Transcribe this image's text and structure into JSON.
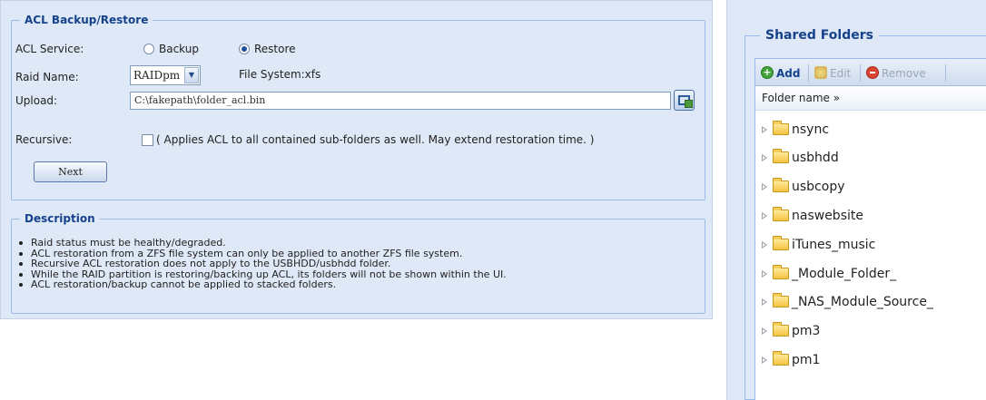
{
  "backup_section": {
    "title": "ACL Backup/Restore",
    "acl_service_label": "ACL Service:",
    "option_backup": "Backup",
    "option_restore": "Restore",
    "selected_option": "Restore",
    "raid_name_label": "Raid Name:",
    "raid_name_value": "RAIDpm",
    "file_system_text": "File System:xfs",
    "upload_label": "Upload:",
    "upload_value": "C:\\fakepath\\folder_acl.bin",
    "recursive_label": "Recursive:",
    "recursive_checked": false,
    "recursive_text": "( Applies ACL to all contained sub-folders as well. May extend restoration time. )",
    "next_button": "Next"
  },
  "description_section": {
    "title": "Description",
    "items": [
      "Raid status must be healthy/degraded.",
      "ACL restoration from a ZFS file system can only be applied to another ZFS file system.",
      "Recursive ACL restoration does not apply to the USBHDD/usbhdd folder.",
      "While the RAID partition is restoring/backing up ACL, its folders will not be shown within the UI.",
      "ACL restoration/backup cannot be applied to stacked folders."
    ]
  },
  "shared_folders": {
    "title": "Shared Folders",
    "toolbar": {
      "add": "Add",
      "edit": "Edit",
      "remove": "Remove"
    },
    "column_header": "Folder name »",
    "folders": [
      "nsync",
      "usbhdd",
      "usbcopy",
      "naswebsite",
      "iTunes_music",
      "_Module_Folder_",
      "_NAS_Module_Source_",
      "pm3",
      "pm1"
    ]
  },
  "colors": {
    "panel_bg": "#dfe8f6",
    "legend_text": "#15428b",
    "add_icon": "#3fa33a",
    "remove_icon": "#d9432f",
    "disabled_text": "#9aa7b8"
  },
  "icons": {
    "upload": "browse-file-icon",
    "add": "add-icon",
    "edit": "edit-icon",
    "remove": "remove-icon",
    "folder": "folder-icon",
    "expand": "expand-arrow-icon"
  }
}
